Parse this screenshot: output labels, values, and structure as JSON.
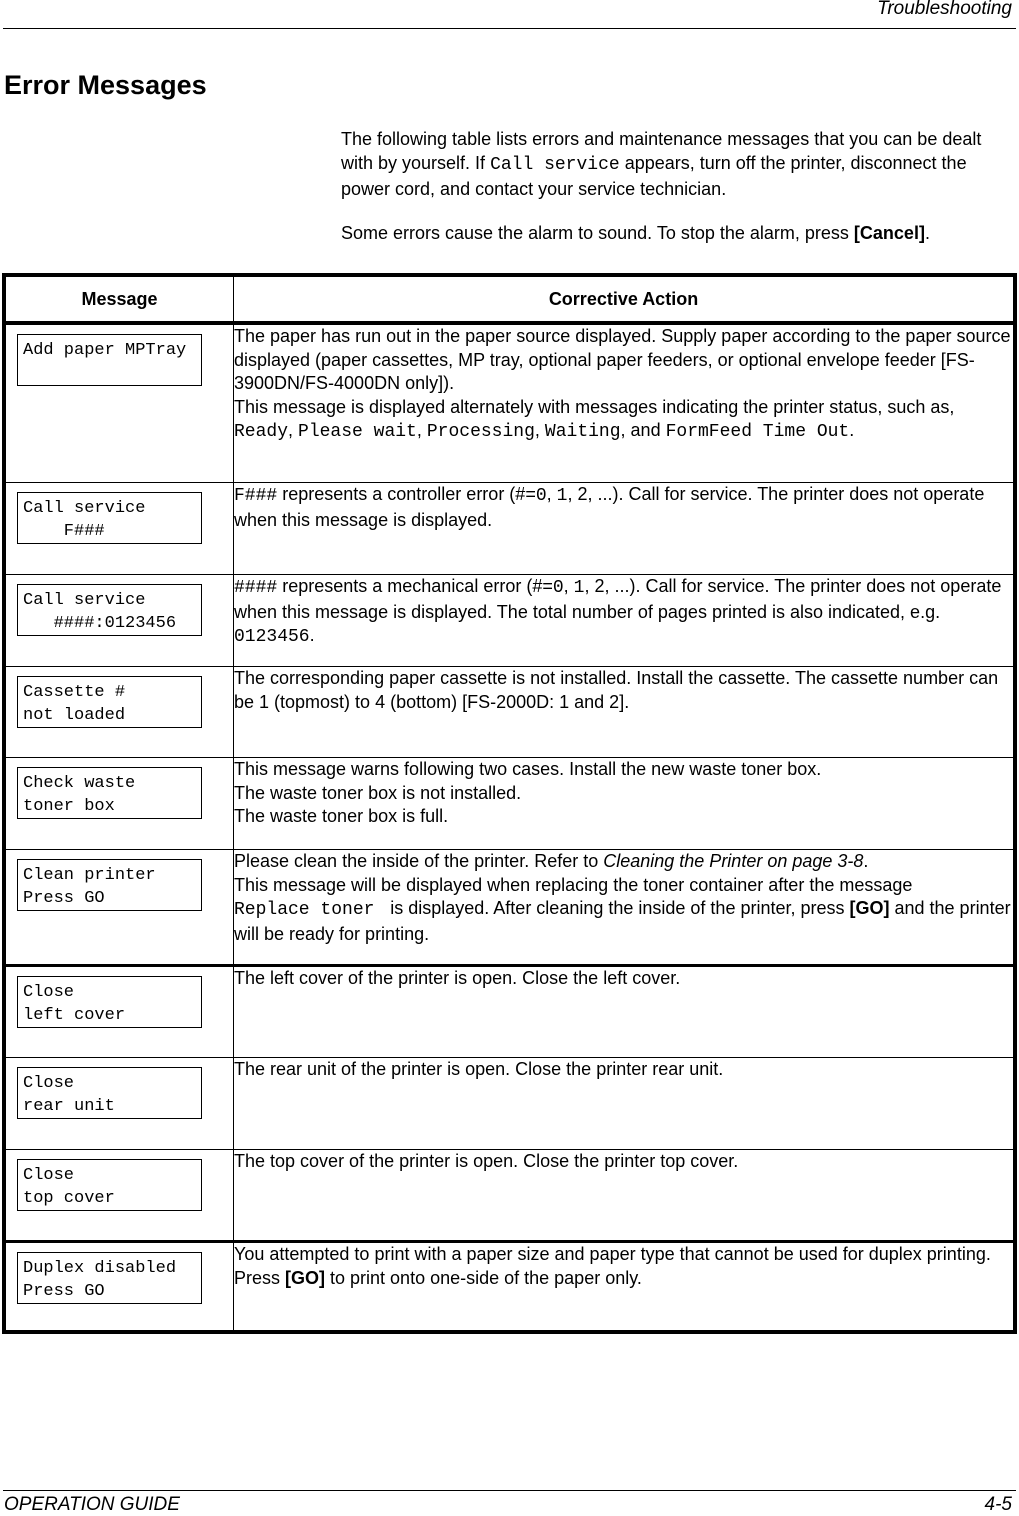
{
  "header": {
    "section": "Troubleshooting"
  },
  "page_title": "Error Messages",
  "intro": {
    "p1_a": "The following table lists errors and maintenance messages that you can be dealt with by yourself. If ",
    "p1_code": "Call service",
    "p1_b": " appears, turn off the printer, disconnect the power cord, and contact your service technician.",
    "p2_a": "Some errors cause the alarm to sound. To stop the alarm, press ",
    "p2_key": "[Cancel]",
    "p2_b": "."
  },
  "table": {
    "headers": {
      "message": "Message",
      "action": "Corrective Action"
    },
    "rows": [
      {
        "message": "Add paper MPTray",
        "action": {
          "l1": "The paper has run out in the paper source displayed. Supply paper according to the paper source displayed (paper cassettes, MP tray, optional paper feeders, or optional envelope feeder [FS-3900DN/FS-4000DN only]).",
          "l2_a": "This message is displayed alternately with messages indicating the printer status, such as, ",
          "code1": "Ready",
          "sep1": ", ",
          "code2": "Please wait",
          "sep2": ", ",
          "code3": "Processing",
          "sep3": ", ",
          "code4": "Waiting",
          "sep4": ", and ",
          "code5": "FormFeed Time Out",
          "end": "."
        }
      },
      {
        "message": "Call service\n    F###",
        "action": {
          "code1": "F###",
          "a": " represents a controller error (#=",
          "code2": "0",
          "b": ", ",
          "code3": "1",
          "c": ", 2, ...). Call for service. The printer does not operate when this message is displayed."
        }
      },
      {
        "message": "Call service\n   ####:0123456",
        "action": {
          "code1": "####",
          "a": " represents a mechanical error (#=",
          "code2": "0",
          "b": ", ",
          "code3": "1",
          "c": ", 2, ...). Call for service. The printer does not operate when this message is displayed. The total number of pages printed is also indicated, e.g. ",
          "code4": "0123456",
          "d": "."
        }
      },
      {
        "message": "Cassette #\nnot loaded",
        "action": {
          "text": "The corresponding paper cassette is not installed. Install the cassette. The cassette number can be 1 (topmost) to 4 (bottom) [FS-2000D: 1 and 2]."
        }
      },
      {
        "message": "Check waste\ntoner box",
        "action": {
          "l1": "This message warns following two cases. Install the new waste toner box.",
          "l2": "The waste toner box is not installed.",
          "l3": "The waste toner box is full."
        }
      },
      {
        "message": "Clean printer\nPress GO",
        "action": {
          "a": "Please clean the inside of the printer. Refer to ",
          "ref": "Cleaning the Printer on page 3-8",
          "b": ".",
          "c": "This message will be displayed when replacing the toner container after the message ",
          "code1": "Replace toner ",
          "d": " is displayed. After cleaning the inside of the printer, press ",
          "key": "[GO]",
          "e": " and the printer will be ready for printing."
        }
      },
      {
        "message": "Close\nleft cover",
        "action": {
          "text": "The left cover of the printer is open. Close the left cover."
        }
      },
      {
        "message": "Close\nrear unit",
        "action": {
          "text": "The rear unit of the printer is open. Close the printer rear unit."
        }
      },
      {
        "message": "Close\ntop cover",
        "action": {
          "text": "The top cover of the printer is open. Close the printer top cover."
        }
      },
      {
        "message": "Duplex disabled\nPress GO",
        "action": {
          "a": "You attempted to print with a paper size and paper type that cannot be used for duplex printing. Press ",
          "key": "[GO]",
          "b": " to print onto one-side of the paper only."
        }
      }
    ]
  },
  "footer": {
    "guide": "OPERATION GUIDE",
    "page": "4-5"
  }
}
